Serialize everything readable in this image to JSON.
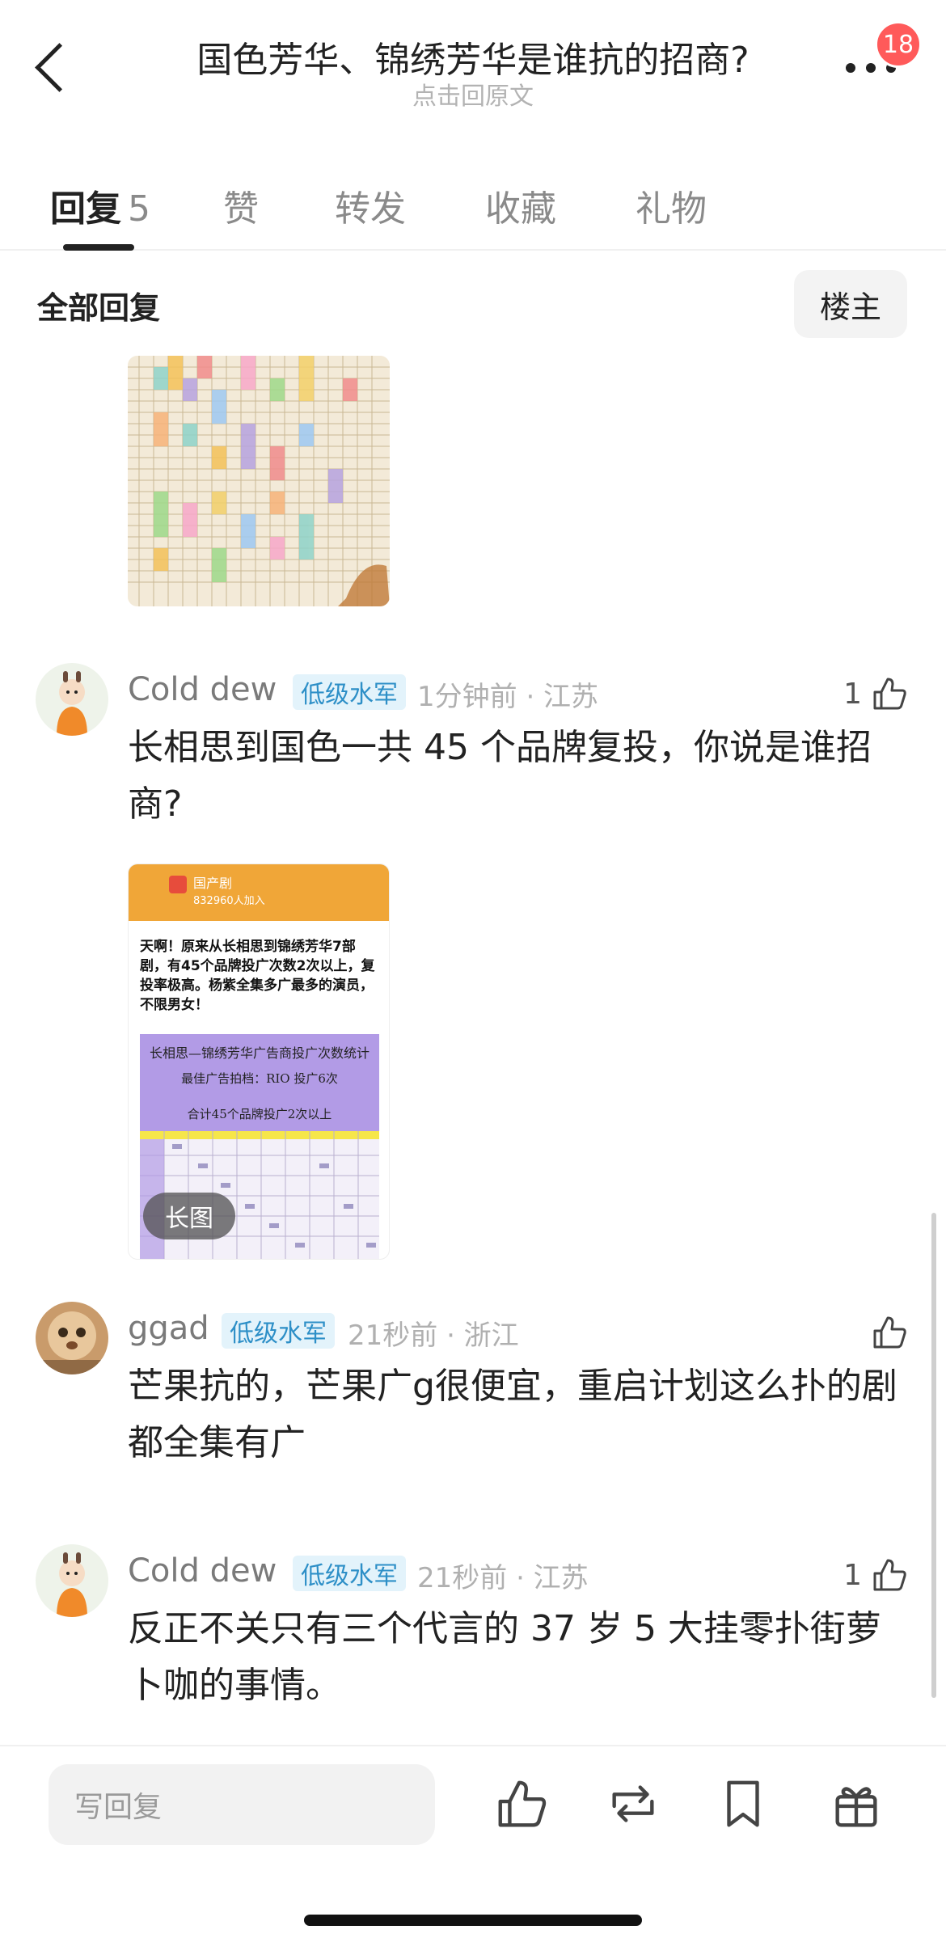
{
  "header": {
    "title": "国色芳华、锦绣芳华是谁抗的招商?",
    "subtitle": "点击回原文",
    "notification_count": "18"
  },
  "tabs": [
    {
      "label": "回复",
      "count": "5"
    },
    {
      "label": "赞"
    },
    {
      "label": "转发"
    },
    {
      "label": "收藏"
    },
    {
      "label": "礼物"
    }
  ],
  "section": {
    "title": "全部回复",
    "op_filter": "楼主"
  },
  "comments": [
    {
      "username": "Cold dew",
      "rank": "低级水军",
      "meta": "1分钟前 · 江苏",
      "likes": "1",
      "content": "长相思到国色一共 45 个品牌复投，你说是谁招商?",
      "image": {
        "group_name": "国产剧",
        "members": "832960人加入",
        "headline": "天啊！原来从长相思到锦绣芳华7部剧，有45个品牌投广次数2次以上，复投率极高。杨紫全集多广最多的演员，不限男女！",
        "table_title": "长相思—锦绣芳华广告商投广次数统计",
        "best_partner": "最佳广告拍档：RIO 投广6次",
        "total": "合计45个品牌投广2次以上",
        "long_tag": "长图"
      }
    },
    {
      "username": "ggad",
      "rank": "低级水军",
      "meta": "21秒前 · 浙江",
      "likes": "",
      "content": "芒果抗的，芒果广g很便宜，重启计划这么扑的剧都全集有广"
    },
    {
      "username": "Cold dew",
      "rank": "低级水军",
      "meta": "21秒前 · 江苏",
      "likes": "1",
      "content": "反正不关只有三个代言的 37 岁 5 大挂零扑街萝卜咖的事情。"
    }
  ],
  "bottom_bar": {
    "reply_placeholder": "写回复"
  },
  "colors": {
    "rank_bg": "#e3f3fb",
    "rank_text": "#2d8fc7",
    "badge": "#ff5a5a"
  }
}
